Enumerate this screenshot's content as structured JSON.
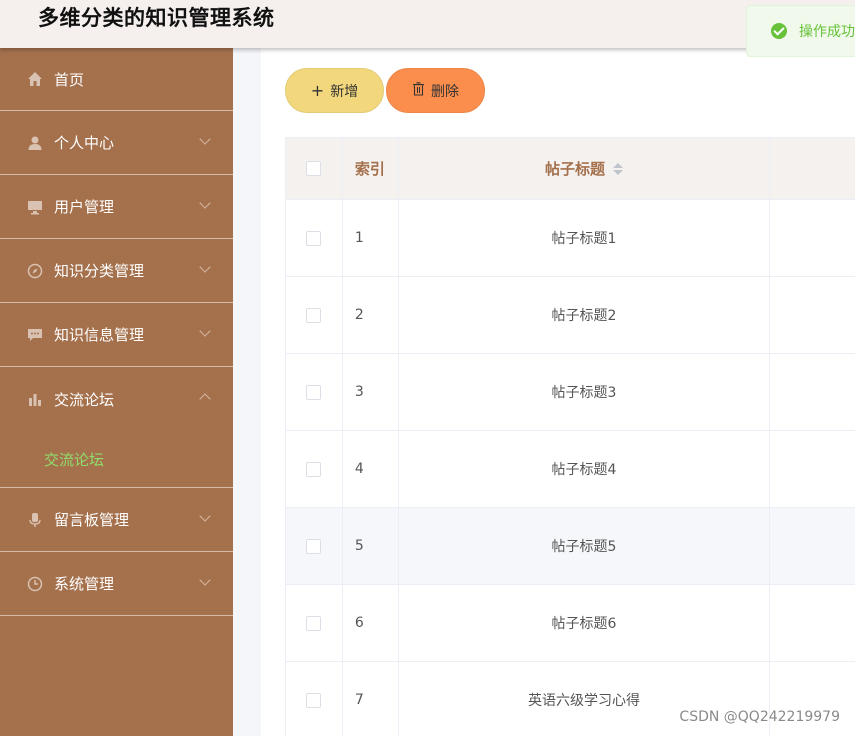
{
  "header": {
    "title": "多维分类的知识管理系统"
  },
  "toast": {
    "message": "操作成功",
    "color": "#67c23a"
  },
  "sidebar": {
    "background": "#a5714d",
    "items": [
      {
        "label": "首页",
        "icon": "home-icon"
      },
      {
        "label": "个人中心",
        "icon": "user-icon"
      },
      {
        "label": "用户管理",
        "icon": "monitor-icon"
      },
      {
        "label": "知识分类管理",
        "icon": "compass-icon"
      },
      {
        "label": "知识信息管理",
        "icon": "chat-icon"
      },
      {
        "label": "交流论坛",
        "icon": "bar-chart-icon",
        "expanded": true,
        "children": [
          {
            "label": "交流论坛"
          }
        ]
      },
      {
        "label": "留言板管理",
        "icon": "microphone-icon"
      },
      {
        "label": "系统管理",
        "icon": "clock-icon"
      }
    ]
  },
  "toolbar": {
    "add_label": "新增",
    "delete_label": "删除"
  },
  "table": {
    "columns": {
      "index": "索引",
      "title": "帖子标题"
    },
    "rows": [
      {
        "index": "1",
        "title": "帖子标题1"
      },
      {
        "index": "2",
        "title": "帖子标题2"
      },
      {
        "index": "3",
        "title": "帖子标题3"
      },
      {
        "index": "4",
        "title": "帖子标题4"
      },
      {
        "index": "5",
        "title": "帖子标题5"
      },
      {
        "index": "6",
        "title": "帖子标题6"
      },
      {
        "index": "7",
        "title": "英语六级学习心得"
      }
    ]
  },
  "watermark": "CSDN @QQ242219979"
}
